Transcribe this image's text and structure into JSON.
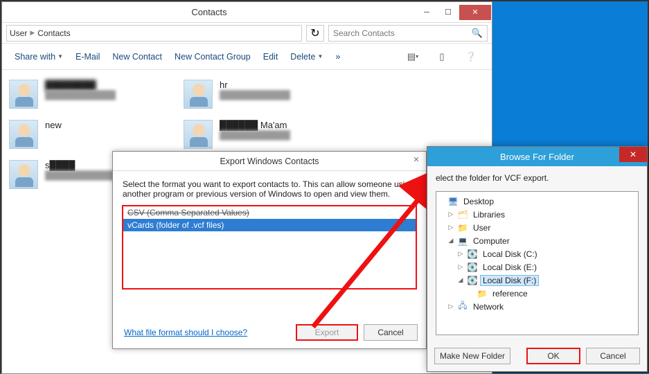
{
  "contacts_window": {
    "title": "Contacts",
    "breadcrumb": {
      "seg1": "User",
      "seg2": "Contacts"
    },
    "search_placeholder": "Search Contacts",
    "toolbar": {
      "share": "Share with",
      "email": "E-Mail",
      "new_contact": "New Contact",
      "new_group": "New Contact Group",
      "edit": "Edit",
      "delete": "Delete"
    },
    "contacts": [
      {
        "name": "████████",
        "name_blur": true,
        "sub": "████████████"
      },
      {
        "name": "hr",
        "name_blur": false,
        "sub": "████████████"
      },
      {
        "name": "new",
        "name_blur": false,
        "sub": ""
      },
      {
        "name": "██████ Ma'am",
        "name_blur": false,
        "sub": "████████████"
      },
      {
        "name": "s████",
        "name_blur": false,
        "sub": "████████████"
      }
    ]
  },
  "export_dialog": {
    "title": "Export Windows Contacts",
    "instruction": "Select the format you want to export contacts to.  This can allow someone using another program or previous version of Windows to open and view them.",
    "option_csv": "CSV (Comma Separated Values)",
    "option_vcf": "vCards (folder of .vcf files)",
    "help_link": "What file format should I choose?",
    "export_btn": "Export",
    "cancel_btn": "Cancel"
  },
  "browse_dialog": {
    "title": "Browse For Folder",
    "instruction": "elect the folder for VCF export.",
    "tree": {
      "desktop": "Desktop",
      "libraries": "Libraries",
      "user": "User",
      "computer": "Computer",
      "disk_c": "Local Disk (C:)",
      "disk_e": "Local Disk (E:)",
      "disk_f": "Local Disk (F:)",
      "reference": "reference",
      "network": "Network"
    },
    "make_folder_btn": "Make New Folder",
    "ok_btn": "OK",
    "cancel_btn": "Cancel"
  }
}
